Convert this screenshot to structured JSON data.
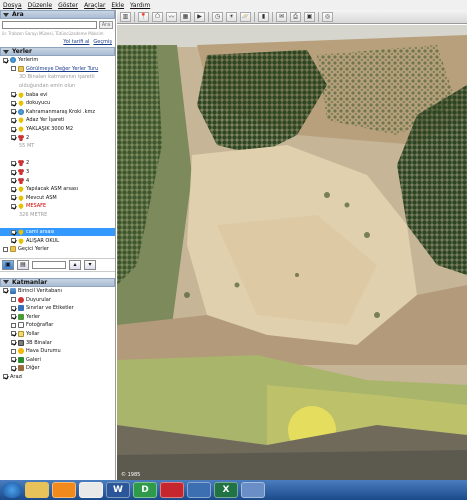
{
  "menu": [
    "Dosya",
    "Düzenle",
    "Göster",
    "Araçlar",
    "Ekle",
    "Yardım"
  ],
  "search": {
    "title": "Ara",
    "button": "Ara",
    "hint": "ör. Trabzon Sarayı Müzesi, Tütüncüzademe Maksim",
    "links": [
      "Yol tarifi al",
      "Geçmiş"
    ]
  },
  "places": {
    "title": "Yerler",
    "items": [
      {
        "label": "Yerlerim",
        "icon": "earth-icon",
        "indent": 0,
        "check": true,
        "style": ""
      },
      {
        "label": "Görülmeye Değer Yerler Turu",
        "icon": "folder-icon",
        "indent": 1,
        "check": false,
        "style": "link"
      },
      {
        "label": "3D Binaları katmanının işaretli",
        "icon": "",
        "indent": 2,
        "check": false,
        "style": "gray"
      },
      {
        "label": "olduğundan emin olun",
        "icon": "",
        "indent": 2,
        "check": false,
        "style": "gray"
      },
      {
        "label": "baba evi",
        "icon": "pin-icon",
        "indent": 1,
        "check": true,
        "style": ""
      },
      {
        "label": "dokuyucu",
        "icon": "pin-icon",
        "indent": 1,
        "check": true,
        "style": ""
      },
      {
        "label": "Kahramanmaraş Kroki .kmz",
        "icon": "earth-icon",
        "indent": 1,
        "check": true,
        "style": ""
      },
      {
        "label": "Adaz Yer İşareti",
        "icon": "pin-icon",
        "indent": 1,
        "check": true,
        "style": ""
      },
      {
        "label": "YAKLAŞIK 3000 M2",
        "icon": "pin-icon",
        "indent": 1,
        "check": true,
        "style": ""
      },
      {
        "label": "2",
        "icon": "dots-icon",
        "indent": 1,
        "check": true,
        "style": ""
      },
      {
        "label": "55 MT",
        "icon": "",
        "indent": 2,
        "check": false,
        "style": "gray"
      },
      {
        "label": "",
        "icon": "",
        "indent": 1,
        "check": false,
        "style": ""
      },
      {
        "label": "2",
        "icon": "dots-icon",
        "indent": 1,
        "check": true,
        "style": ""
      },
      {
        "label": "3",
        "icon": "dots-icon",
        "indent": 1,
        "check": true,
        "style": ""
      },
      {
        "label": "4",
        "icon": "dots-icon",
        "indent": 1,
        "check": true,
        "style": ""
      },
      {
        "label": "Yapılacak ASM arsası",
        "icon": "pin-icon",
        "indent": 1,
        "check": true,
        "style": ""
      },
      {
        "label": "Mevcut ASM",
        "icon": "pin-icon",
        "indent": 1,
        "check": true,
        "style": ""
      },
      {
        "label": "MESAFE",
        "icon": "pin-icon",
        "indent": 1,
        "check": true,
        "style": "red"
      },
      {
        "label": "326 METRE",
        "icon": "",
        "indent": 2,
        "check": false,
        "style": "gray"
      },
      {
        "label": "",
        "icon": "",
        "indent": 1,
        "check": false,
        "style": ""
      },
      {
        "label": "cami arsası",
        "icon": "pin-icon",
        "indent": 1,
        "check": true,
        "style": "selected"
      },
      {
        "label": "ALIŞAR OKUL",
        "icon": "pin-icon",
        "indent": 1,
        "check": true,
        "style": ""
      },
      {
        "label": "Geçici Yerler",
        "icon": "folder-icon",
        "indent": 0,
        "check": false,
        "style": ""
      }
    ]
  },
  "layers": {
    "title": "Katmanlar",
    "items": [
      {
        "label": "Birincil Veritabanı",
        "icon": "layers-icon",
        "indent": 0,
        "check": true
      },
      {
        "label": "Duyurular",
        "icon": "red-dot-icon",
        "indent": 1,
        "check": false
      },
      {
        "label": "Sınırlar ve Etiketler",
        "icon": "border-icon",
        "indent": 1,
        "check": true
      },
      {
        "label": "Yerler",
        "icon": "places-icon",
        "indent": 1,
        "check": true
      },
      {
        "label": "Fotoğraflar",
        "icon": "photo-icon",
        "indent": 1,
        "check": false
      },
      {
        "label": "Yollar",
        "icon": "road-icon",
        "indent": 1,
        "check": true
      },
      {
        "label": "3B Binalar",
        "icon": "building-icon",
        "indent": 1,
        "check": true
      },
      {
        "label": "Hava Durumu",
        "icon": "weather-icon",
        "indent": 1,
        "check": false
      },
      {
        "label": "Galeri",
        "icon": "gallery-icon",
        "indent": 1,
        "check": true
      },
      {
        "label": "Diğer",
        "icon": "other-icon",
        "indent": 1,
        "check": true
      },
      {
        "label": "Arazi",
        "icon": "",
        "indent": 0,
        "check": true
      }
    ]
  },
  "map": {
    "copyright": "© 1985"
  },
  "taskbar": {
    "apps": [
      "start",
      "explorer",
      "media",
      "chrome",
      "word",
      "d-app",
      "pdf",
      "google-earth",
      "excel",
      "photos"
    ],
    "labels": {
      "word": "W",
      "d-app": "D",
      "excel": "X"
    }
  }
}
